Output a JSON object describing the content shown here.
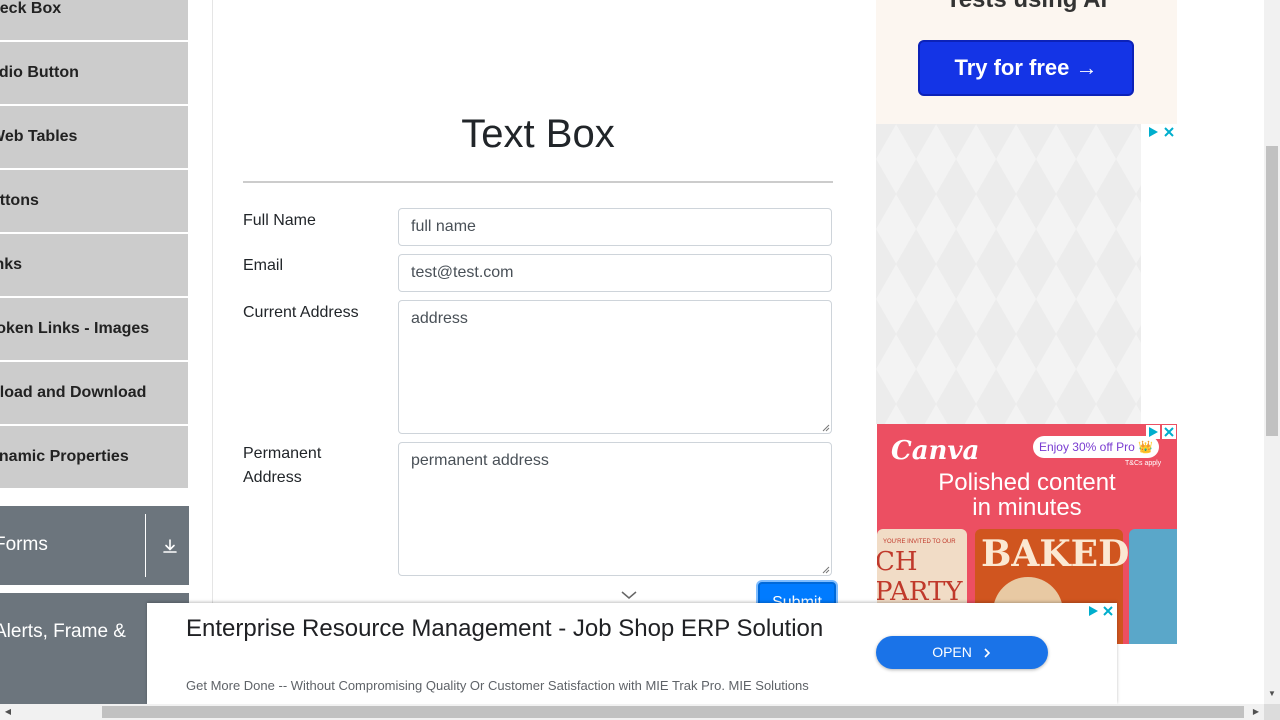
{
  "sidebar": {
    "items": [
      {
        "label": "heck Box"
      },
      {
        "label": "adio Button"
      },
      {
        "label": "Web Tables"
      },
      {
        "label": "uttons"
      },
      {
        "label": "inks"
      },
      {
        "label": "roken Links - Images"
      },
      {
        "label": "pload and Download"
      },
      {
        "label": "ynamic Properties"
      }
    ],
    "groups": [
      {
        "label": "Forms",
        "icon": "download-icon"
      },
      {
        "label": "Alerts, Frame &"
      }
    ]
  },
  "main": {
    "title": "Text Box",
    "fields": {
      "full_name": {
        "label": "Full Name",
        "placeholder": "full name"
      },
      "email": {
        "label": "Email",
        "value": "test@test.com"
      },
      "current_address": {
        "label": "Current Address",
        "placeholder": "address"
      },
      "permanent_address": {
        "label": "Permanent Address",
        "placeholder": "permanent address"
      }
    },
    "submit_label": "Submit"
  },
  "ads": {
    "top": {
      "tagline": "Tests using AI",
      "cta": "Try for free →"
    },
    "canva": {
      "brand": "Canva",
      "pill": "Enjoy 30% off Pro 👑",
      "pill_sub": "T&Cs apply",
      "headline_line1": "Polished content",
      "headline_line2": "in minutes",
      "card1_small": "YOU'RE INVITED TO OUR",
      "card1_big": "CH PARTY",
      "card2_big": "BAKED"
    },
    "bottom": {
      "headline": "Enterprise Resource Management - Job Shop ERP Solution",
      "description": "Get More Done -- Without Compromising Quality Or Customer Satisfaction with MIE Trak Pro. MIE Solutions",
      "cta": "OPEN"
    }
  },
  "colors": {
    "sidebar_bg": "#cccccc",
    "group_bg": "#6c757d",
    "primary": "#007bff",
    "ad_cta_blue": "#1434e6",
    "canva_bg": "#ec4f62"
  }
}
